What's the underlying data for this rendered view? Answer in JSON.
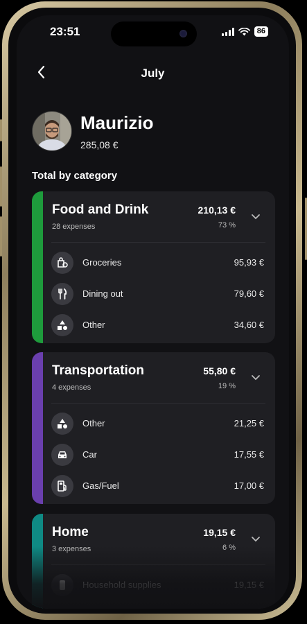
{
  "status_bar": {
    "time": "23:51",
    "battery": "86"
  },
  "nav": {
    "title": "July"
  },
  "user": {
    "name": "Maurizio",
    "total": "285,08 €"
  },
  "section_title": "Total by category",
  "colors": {
    "food": "#1e9b3c",
    "transport": "#6a3fae",
    "home": "#0f8a84"
  },
  "categories": [
    {
      "name": "Food and Drink",
      "count": "28 expenses",
      "amount": "210,13 €",
      "percent": "73 %",
      "items": [
        {
          "label": "Groceries",
          "amount": "95,93 €",
          "icon": "grocery-bag-icon"
        },
        {
          "label": "Dining out",
          "amount": "79,60 €",
          "icon": "fork-knife-icon"
        },
        {
          "label": "Other",
          "amount": "34,60 €",
          "icon": "shapes-icon"
        }
      ]
    },
    {
      "name": "Transportation",
      "count": "4 expenses",
      "amount": "55,80 €",
      "percent": "19 %",
      "items": [
        {
          "label": "Other",
          "amount": "21,25 €",
          "icon": "shapes-icon"
        },
        {
          "label": "Car",
          "amount": "17,55 €",
          "icon": "car-icon"
        },
        {
          "label": "Gas/Fuel",
          "amount": "17,00 €",
          "icon": "fuel-pump-icon"
        }
      ]
    },
    {
      "name": "Home",
      "count": "3 expenses",
      "amount": "19,15 €",
      "percent": "6 %",
      "items": [
        {
          "label": "Household supplies",
          "amount": "19,15 €",
          "icon": "household-icon"
        }
      ]
    }
  ]
}
